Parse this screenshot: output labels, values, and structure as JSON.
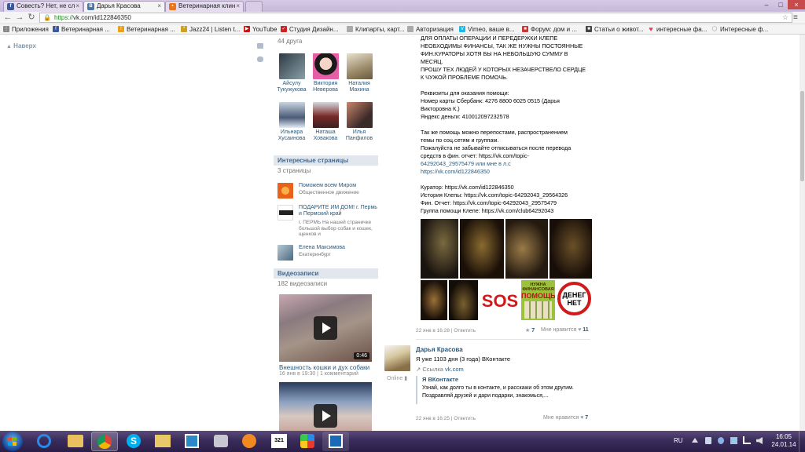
{
  "browser": {
    "tabs": [
      {
        "title": "Совесть? Нет, не сл",
        "icon": "vk-icon",
        "color": "#3b5998"
      },
      {
        "title": "Дарья Красова",
        "icon": "vk-icon",
        "color": "#4a76a8"
      },
      {
        "title": "Ветеринарная клин",
        "icon": "orange-square-icon",
        "color": "#e8761a"
      }
    ],
    "url_https": "https://",
    "url_rest": "vk.com/id122846350",
    "bookmarks": [
      {
        "label": "Приложения",
        "icon": "apps-grid-icon",
        "color": "#888888"
      },
      {
        "label": "Ветеринарная ...",
        "icon": "vk-icon",
        "color": "#3b5998"
      },
      {
        "label": "Ветеринарная ...",
        "icon": "warning-triangle-icon",
        "color": "#e8a21a"
      },
      {
        "label": "Jazz24 | Listen t...",
        "icon": "burst-icon",
        "color": "#d0a020"
      },
      {
        "label": "YouTube",
        "icon": "youtube-icon",
        "color": "#cc1111"
      },
      {
        "label": "Студия Дизайн...",
        "icon": "checkmark-icon",
        "color": "#cc2222"
      },
      {
        "label": "Клипарты, карт...",
        "icon": "page-icon",
        "color": "#aaaaaa"
      },
      {
        "label": "Авторизация",
        "icon": "page-icon",
        "color": "#aaaaaa"
      },
      {
        "label": "Vimeo, ваше в...",
        "icon": "vimeo-icon",
        "color": "#1ab7ea"
      },
      {
        "label": "Форум: дом и ...",
        "icon": "forum-icon",
        "color": "#cc3333"
      },
      {
        "label": "Статьи о живот...",
        "icon": "paw-icon",
        "color": "#444444"
      },
      {
        "label": "интересные фа...",
        "icon": "heart-icon",
        "color": "#e0405a"
      },
      {
        "label": "Интересные ф...",
        "icon": "bulb-icon",
        "color": "#888888"
      }
    ]
  },
  "page": {
    "naverh": "Наверх",
    "friends_count": "44 друга",
    "friends": [
      {
        "first": "Айсулу",
        "last": "Тукужукова",
        "color": "#5a6a7a"
      },
      {
        "first": "Виктория",
        "last": "Неверова",
        "color": "#d65a9a"
      },
      {
        "first": "Наталия",
        "last": "Махина",
        "color": "#b7a58a"
      },
      {
        "first": "Ильнара",
        "last": "Хусаинова",
        "color": "#7a8aa8"
      },
      {
        "first": "Наташа",
        "last": "Ховакова",
        "color": "#5a3c3c"
      },
      {
        "first": "Илья",
        "last": "Панфилов",
        "color": "#9a5a4a"
      }
    ],
    "interesting_header": "Интересные страницы",
    "interesting_count": "3 страницы",
    "pages": [
      {
        "name": "Поможем всем Миром",
        "desc": "Общественное движение",
        "color": "#f28a2e"
      },
      {
        "name": "ПОДАРИТЕ ИМ ДОМ! г. Пермь и Пермский край",
        "desc": "г. ПЕРМЬ На нашей страничке большой выбор собак и кошек, щенков и",
        "color": "#333333"
      },
      {
        "name": "Елена Максимова",
        "desc": "Екатеринбург",
        "color": "#6a8aa0"
      }
    ],
    "videos_header": "Видеозаписи",
    "videos_count": "182 видеозаписи",
    "videos": [
      {
        "title": "Внешность кошки и дух собаки",
        "meta": "16 янв в 19:30 | 1 комментарий",
        "duration": "0:46"
      },
      {
        "title": "",
        "meta": "",
        "duration": ""
      }
    ]
  },
  "post": {
    "lines": [
      {
        "t": "ДЛЯ ОПЛАТЫ ОПЕРАЦИИ И ПЕРЕДЕРЖКИ КЛЕПЕ",
        "link": false
      },
      {
        "t": "НЕОБХОДИМЫ ФИНАНСЫ, ТАК ЖЕ НУЖНЫ ПОСТОЯННЫЕ",
        "link": false
      },
      {
        "t": "ФИН.КУРАТОРЫ ХОТЯ БЫ НА НЕБОЛЬШУЮ СУММУ В",
        "link": false
      },
      {
        "t": "МЕСЯЦ.",
        "link": false
      },
      {
        "t": "ПРОШУ ТЕХ ЛЮДЕЙ У КОТОРЫХ НЕЗАЧЕРСТВЕЛО СЕРДЦЕ",
        "link": false
      },
      {
        "t": "К ЧУЖОЙ ПРОБЛЕМЕ ПОМОЧЬ.",
        "link": false
      },
      {
        "t": "",
        "link": false
      },
      {
        "t": "Реквизиты для оказания помощи:",
        "link": false
      },
      {
        "t": "Номер карты Сбербанк: 4276 8800 6025 0515 (Дарья",
        "link": false
      },
      {
        "t": "Викторовна К.)",
        "link": false
      },
      {
        "t": "Яндекс деньги: 410012097232578",
        "link": false
      },
      {
        "t": "",
        "link": false
      },
      {
        "t": "Так же помощь можно перепостами, распространением",
        "link": false
      },
      {
        "t": "темы по соц.сетям и группам.",
        "link": false
      },
      {
        "t": "Пожалуйста не забывайте отписываться после перевода",
        "link": false
      },
      {
        "t": "средств в фин. отчет: https://vk.com/topic-",
        "link": false
      },
      {
        "t": "64292043_29575479 или мне в л.с",
        "link": false
      },
      {
        "t": "https://vk.com/id122846350",
        "link": true
      },
      {
        "t": "",
        "link": false
      },
      {
        "t": "Куратор: https://vk.com/id122846350",
        "link": false
      },
      {
        "t": "История Клепы: https://vk.com/topic-64292043_29564326",
        "link": false
      },
      {
        "t": "Фин. Отчет: https://vk.com/topic-64292043_29575479",
        "link": false
      },
      {
        "t": "Группа помощи Клепе: https://vk.com/club64292043",
        "link": false
      }
    ],
    "meta": "22 янв в 16:28 | Ответить",
    "likes_label": "Мне нравится",
    "likes": "11",
    "shares": "7",
    "sign_top": "НУЖНА ФИНАНСОВАЯ",
    "sign_bottom": "ПОМОЩЬ",
    "sos": "SOS",
    "no_money_1": "ДЕНЕГ",
    "no_money_2": "НЕТ"
  },
  "post2": {
    "author": "Дарья Красова",
    "online": "Online",
    "text": "Я уже 1103 дня (3 года) ВКонтакте",
    "link_label": "Ссылка",
    "link_text": "vk.com",
    "quote_title": "Я ВКонтакте",
    "quote_line1": "Узнай, как долго ты в контакте, и расскажи об этом другим.",
    "quote_line2": "Поздравляй друзей и дари подарки, знакомься,...",
    "meta": "22 янв в 16:25 | Ответить",
    "likes_label": "Мне нравится",
    "likes": "7"
  },
  "taskbar": {
    "lang": "RU",
    "time": "16:05",
    "date": "24.01.14",
    "badge": "321"
  }
}
